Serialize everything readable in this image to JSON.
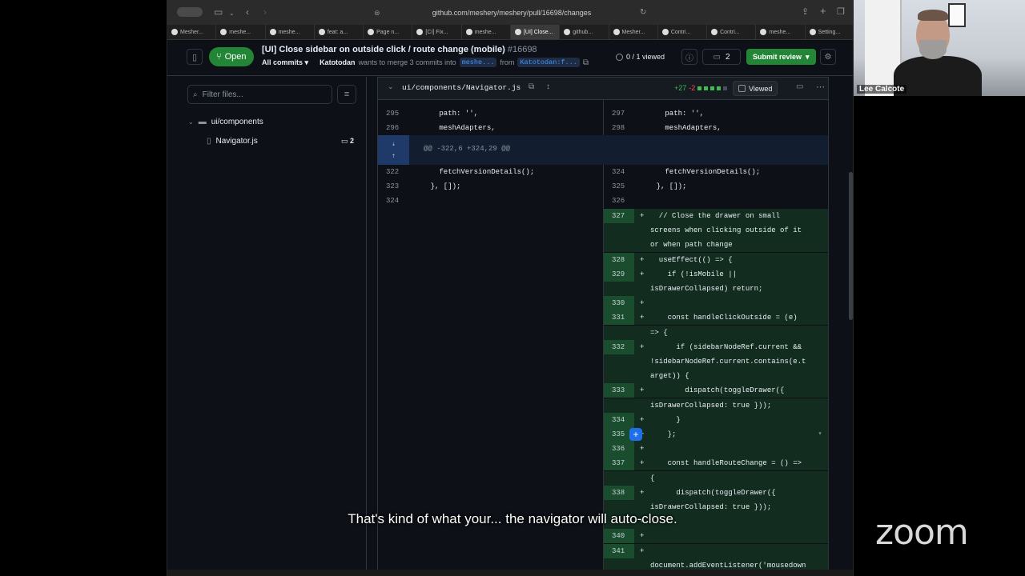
{
  "browser": {
    "url": "github.com/meshery/meshery/pull/16698/changes",
    "tabs": [
      "Mesher...",
      "meshe...",
      "meshe...",
      "feat: a...",
      "Page n...",
      "[CI] Fix...",
      "meshe...",
      "[UI] Close...",
      "github...",
      "Mesher...",
      "Contri...",
      "Contri...",
      "meshe...",
      "Setting..."
    ],
    "active_tab": 7
  },
  "pr": {
    "state": "Open",
    "title": "[UI] Close sidebar on outside click / route change (mobile)",
    "number": "#16698",
    "commits_label": "All commits",
    "author": "Katotodan",
    "merge_text": "wants to merge 3 commits into",
    "base_branch": "meshe...",
    "from_text": "from",
    "head_branch": "Katotodan:f...",
    "viewed": "0 / 1 viewed",
    "comments_count": "2",
    "submit_label": "Submit review"
  },
  "filetree": {
    "filter_placeholder": "Filter files...",
    "folder": "ui/components",
    "file": "Navigator.js",
    "file_comments": "2"
  },
  "diff": {
    "filename": "ui/components/Navigator.js",
    "additions": "+27",
    "deletions": "-2",
    "viewed_label": "Viewed",
    "hunk_header": "@@ -322,6 +324,29 @@",
    "left_top": [
      {
        "n": "295",
        "code": "      path: '',"
      },
      {
        "n": "296",
        "code": "      meshAdapters,"
      }
    ],
    "right_top": [
      {
        "n": "297",
        "code": "      path: '',"
      },
      {
        "n": "298",
        "code": "      meshAdapters,"
      }
    ],
    "left_after": [
      {
        "n": "322",
        "code": "      fetchVersionDetails();"
      },
      {
        "n": "323",
        "code": "    }, []);"
      },
      {
        "n": "324",
        "code": ""
      }
    ],
    "right_after": [
      {
        "n": "324",
        "code": "      fetchVersionDetails();"
      },
      {
        "n": "325",
        "code": "    }, []);"
      },
      {
        "n": "326",
        "code": ""
      }
    ],
    "added": [
      {
        "n": "327",
        "lines": [
          "  // Close the drawer on small",
          "screens when clicking outside of it",
          "or when path change"
        ]
      },
      {
        "n": "328",
        "lines": [
          "  useEffect(() => {"
        ]
      },
      {
        "n": "329",
        "lines": [
          "    if (!isMobile ||",
          "isDrawerCollapsed) return;"
        ]
      },
      {
        "n": "330",
        "lines": [
          ""
        ]
      },
      {
        "n": "331",
        "lines": [
          "    const handleClickOutside = (e)",
          "=> {"
        ]
      },
      {
        "n": "332",
        "lines": [
          "      if (sidebarNodeRef.current &&",
          "!sidebarNodeRef.current.contains(e.t",
          "arget)) {"
        ]
      },
      {
        "n": "333",
        "lines": [
          "        dispatch(toggleDrawer({",
          "isDrawerCollapsed: true }));"
        ]
      },
      {
        "n": "334",
        "lines": [
          "      }"
        ]
      },
      {
        "n": "335",
        "lines": [
          "    };"
        ]
      },
      {
        "n": "336",
        "lines": [
          ""
        ]
      },
      {
        "n": "337",
        "lines": [
          "    const handleRouteChange = () =>",
          "{"
        ]
      },
      {
        "n": "338",
        "lines": [
          "      dispatch(toggleDrawer({",
          "isDrawerCollapsed: true }));"
        ]
      },
      {
        "n": "",
        "lines": [
          ""
        ]
      },
      {
        "n": "340",
        "lines": [
          ""
        ]
      },
      {
        "n": "341",
        "lines": [
          "",
          "document.addEventListener('mousedown"
        ]
      }
    ]
  },
  "overlay": {
    "participant": "Lee Calcote",
    "caption": "That's kind of what your... the navigator will auto-close.",
    "zoom_logo": "zoom"
  }
}
